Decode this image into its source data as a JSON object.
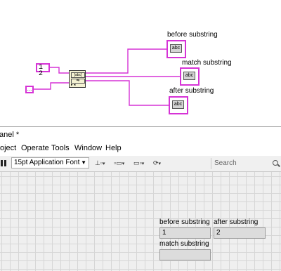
{
  "block_diagram": {
    "indicators": [
      {
        "label": "before substring",
        "text": "abc"
      },
      {
        "label": "match substring",
        "text": "abc"
      },
      {
        "label": "after substring",
        "text": "abc"
      }
    ],
    "constant_value": "1 2",
    "function_text": "[abc]",
    "wire_color": "#d633d6"
  },
  "window": {
    "title": "anel *"
  },
  "menu": [
    "oject",
    "Operate",
    "Tools",
    "Window",
    "Help"
  ],
  "toolbar": {
    "font_select": "15pt Application Font",
    "search_placeholder": "Search"
  },
  "front_panel": {
    "before_substring": {
      "label": "before substring",
      "value": "1"
    },
    "after_substring": {
      "label": "after substring",
      "value": "2"
    },
    "match_substring": {
      "label": "match substring",
      "value": ""
    }
  }
}
